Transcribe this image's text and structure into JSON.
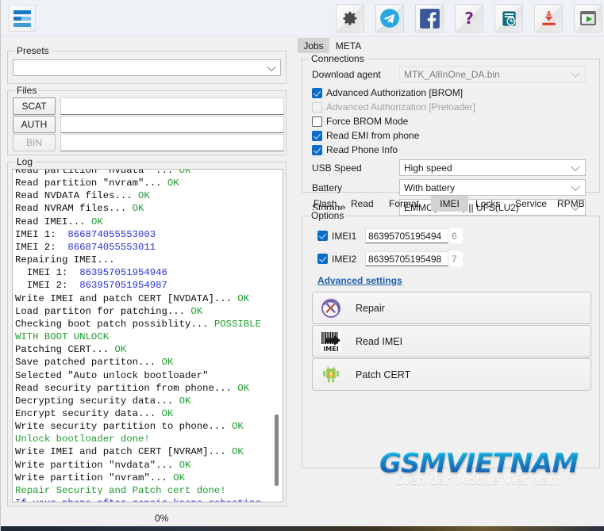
{
  "toolbar": {
    "menu_icon": "hamburger-icon",
    "buttons": [
      {
        "name": "settings-button",
        "icon": "gear-icon",
        "label": "Settings"
      },
      {
        "name": "telegram-button",
        "icon": "telegram-icon",
        "label": "Telegram"
      },
      {
        "name": "facebook-button",
        "icon": "facebook-icon",
        "label": "Facebook"
      },
      {
        "name": "help-button",
        "icon": "question-mark-icon",
        "label": "Help"
      },
      {
        "name": "history-button",
        "icon": "document-clock-icon",
        "label": "History"
      },
      {
        "name": "download-button",
        "icon": "download-arrow-icon",
        "label": "Download"
      },
      {
        "name": "run-button",
        "icon": "play-window-icon",
        "label": "Run"
      }
    ]
  },
  "left": {
    "presets": {
      "legend": "Presets",
      "value": "",
      "placeholder": ""
    },
    "files": {
      "legend": "Files",
      "rows": [
        {
          "button": "SCAT",
          "value": "",
          "enabled": true
        },
        {
          "button": "AUTH",
          "value": "",
          "enabled": true
        },
        {
          "button": "BIN",
          "value": "",
          "enabled": false
        }
      ]
    },
    "log": {
      "legend": "Log",
      "lines": [
        [
          {
            "t": "Read partition \"nvdata\" ... ",
            "c": "k"
          },
          {
            "t": "OK",
            "c": "g"
          }
        ],
        [
          {
            "t": "Read partition \"nvram\"... ",
            "c": "k"
          },
          {
            "t": "OK",
            "c": "g"
          }
        ],
        [
          {
            "t": "Read NVDATA files... ",
            "c": "k"
          },
          {
            "t": "OK",
            "c": "g"
          }
        ],
        [
          {
            "t": "Read NVRAM files... ",
            "c": "k"
          },
          {
            "t": "OK",
            "c": "g"
          }
        ],
        [
          {
            "t": "Read IMEI... ",
            "c": "k"
          },
          {
            "t": "OK",
            "c": "g"
          }
        ],
        [
          {
            "t": "IMEI 1:  ",
            "c": "k"
          },
          {
            "t": "866874055553003",
            "c": "b"
          }
        ],
        [
          {
            "t": "IMEI 2:  ",
            "c": "k"
          },
          {
            "t": "866874055553011",
            "c": "b"
          }
        ],
        [
          {
            "t": "Repairing IMEI...",
            "c": "k"
          }
        ],
        [
          {
            "t": "  IMEI 1:  ",
            "c": "k"
          },
          {
            "t": "863957051954946",
            "c": "b"
          }
        ],
        [
          {
            "t": "  IMEI 2:  ",
            "c": "k"
          },
          {
            "t": "863957051954987",
            "c": "b"
          }
        ],
        [
          {
            "t": "Write IMEI and patch CERT [NVDATA]... ",
            "c": "k"
          },
          {
            "t": "OK",
            "c": "g"
          }
        ],
        [
          {
            "t": "Load partiton for patching... ",
            "c": "k"
          },
          {
            "t": "OK",
            "c": "g"
          }
        ],
        [
          {
            "t": "Checking boot patch possiblity... ",
            "c": "k"
          },
          {
            "t": "POSSIBLE WITH BOOT UNLOCK",
            "c": "g"
          }
        ],
        [
          {
            "t": "Patching CERT... ",
            "c": "k"
          },
          {
            "t": "OK",
            "c": "g"
          }
        ],
        [
          {
            "t": "Save patched partiton... ",
            "c": "k"
          },
          {
            "t": "OK",
            "c": "g"
          }
        ],
        [
          {
            "t": "Selected \"Auto unlock bootloader\"",
            "c": "k"
          }
        ],
        [
          {
            "t": "Read security partition from phone... ",
            "c": "k"
          },
          {
            "t": "OK",
            "c": "g"
          }
        ],
        [
          {
            "t": "Decrypting security data... ",
            "c": "k"
          },
          {
            "t": "OK",
            "c": "g"
          }
        ],
        [
          {
            "t": "Encrypt security data... ",
            "c": "k"
          },
          {
            "t": "OK",
            "c": "g"
          }
        ],
        [
          {
            "t": "Write security partition to phone... ",
            "c": "k"
          },
          {
            "t": "OK",
            "c": "g"
          }
        ],
        [
          {
            "t": "Unlock bootloader done!",
            "c": "g"
          }
        ],
        [
          {
            "t": "Write IMEI and patch CERT [NVRAM]... ",
            "c": "k"
          },
          {
            "t": "OK",
            "c": "g"
          }
        ],
        [
          {
            "t": "Write partition \"nvdata\"... ",
            "c": "k"
          },
          {
            "t": "OK",
            "c": "g"
          }
        ],
        [
          {
            "t": "Write partition \"nvram\"... ",
            "c": "k"
          },
          {
            "t": "OK",
            "c": "g"
          }
        ],
        [
          {
            "t": "Repair Security and Patch cert done!",
            "c": "g"
          }
        ],
        [
          {
            "t": "If your phone after repair keeps rebooting - use wipe data option.",
            "c": "b"
          }
        ]
      ]
    },
    "progress": {
      "percent_label": "0%",
      "value": 0
    }
  },
  "right": {
    "top_tabs": [
      {
        "label": "Jobs",
        "selected": true
      },
      {
        "label": "META",
        "selected": false
      }
    ],
    "connections": {
      "legend": "Connections",
      "download_agent_label": "Download agent",
      "download_agent_value": "MTK_AllInOne_DA.bin",
      "checkboxes": [
        {
          "label": "Advanced Authorization [BROM]",
          "checked": true,
          "enabled": true
        },
        {
          "label": "Advanced Authorization [Preloader]",
          "checked": false,
          "enabled": false
        },
        {
          "label": "Force BROM Mode",
          "checked": false,
          "enabled": true
        },
        {
          "label": "Read EMI from phone",
          "checked": true,
          "enabled": true
        },
        {
          "label": "Read Phone Info",
          "checked": true,
          "enabled": true
        }
      ],
      "usb_speed_label": "USB Speed",
      "usb_speed_value": "High speed",
      "battery_label": "Battery",
      "battery_value": "With battery",
      "storage_label": "Storage",
      "storage_value": "EMMC(USER) || UFS(LU2)"
    },
    "sub_tabs": [
      {
        "label": "Flash",
        "selected": false
      },
      {
        "label": "Read",
        "selected": false
      },
      {
        "label": "Format",
        "selected": false
      },
      {
        "label": "IMEI",
        "selected": true
      },
      {
        "label": "Locks",
        "selected": false
      },
      {
        "label": "Service",
        "selected": false
      },
      {
        "label": "RPMB",
        "selected": false
      }
    ],
    "options": {
      "legend": "Options",
      "imei1": {
        "label": "IMEI1",
        "checked": true,
        "value": "86395705195494",
        "check_digit": "6"
      },
      "imei2": {
        "label": "IMEI2",
        "checked": true,
        "value": "86395705195498",
        "check_digit": "7"
      },
      "advanced_settings_link": "Advanced settings",
      "actions": [
        {
          "label": "Repair",
          "icon": "repair-tools-icon"
        },
        {
          "label": "Read IMEI",
          "icon": "barcode-imei-icon"
        },
        {
          "label": "Patch CERT",
          "icon": "android-warning-icon"
        }
      ]
    }
  },
  "watermark": {
    "title": "GSMVIETNAM",
    "subtitle": "Diễn đàn Mobile Việt Nam"
  },
  "colors": {
    "accent_blue": "#0a6cc9",
    "link_blue": "#1f5fae",
    "log_ok_green": "#1e9b2e",
    "log_value_blue": "#2a32d6",
    "panel_bg": "#f0f0f0",
    "toolbar_bg": "#eef2f7",
    "selected_tab": "#d3d3d3"
  }
}
